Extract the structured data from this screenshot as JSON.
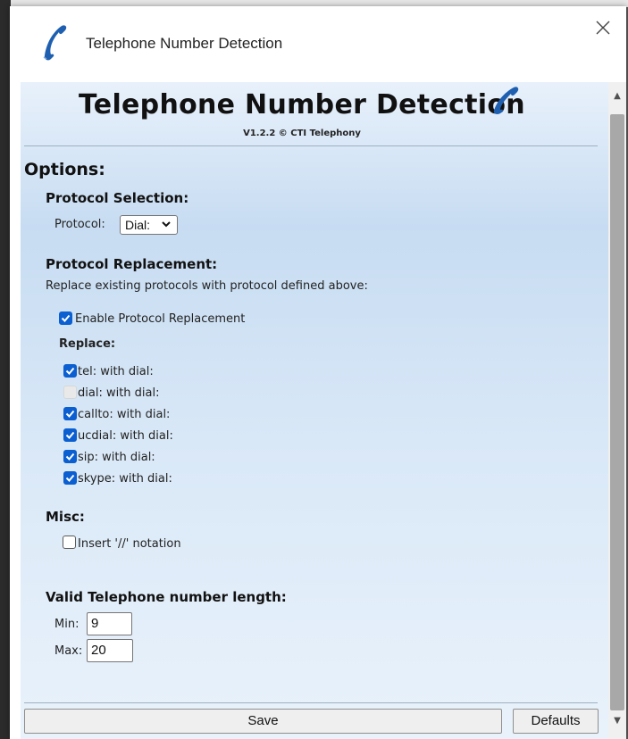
{
  "window": {
    "title": "Telephone Number Detection",
    "close_glyph": "✕"
  },
  "header": {
    "title": "Telephone Number Detection",
    "version": "V1.2.2 © CTI Telephony"
  },
  "options": {
    "heading": "Options:",
    "protocol_selection": {
      "heading": "Protocol Selection:",
      "label": "Protocol:",
      "value": "Dial:"
    },
    "protocol_replacement": {
      "heading": "Protocol Replacement:",
      "description": "Replace existing protocols with protocol defined above:",
      "enable_label": "Enable Protocol Replacement",
      "enable_checked": true,
      "replace_heading": "Replace:",
      "items": [
        {
          "label": "tel: with dial:",
          "checked": true,
          "disabled": false
        },
        {
          "label": "dial: with dial:",
          "checked": false,
          "disabled": true
        },
        {
          "label": "callto: with dial:",
          "checked": true,
          "disabled": false
        },
        {
          "label": "ucdial: with dial:",
          "checked": true,
          "disabled": false
        },
        {
          "label": "sip: with dial:",
          "checked": true,
          "disabled": false
        },
        {
          "label": "skype: with dial:",
          "checked": true,
          "disabled": false
        }
      ]
    },
    "misc": {
      "heading": "Misc:",
      "insert_label": "Insert '//' notation",
      "insert_checked": false
    },
    "length": {
      "heading": "Valid Telephone number length:",
      "min_label": "Min:",
      "min_value": "9",
      "max_label": "Max:",
      "max_value": "20"
    }
  },
  "buttons": {
    "save": "Save",
    "defaults": "Defaults"
  },
  "colors": {
    "accent": "#0b5fd1",
    "icon": "#1f5fb0"
  }
}
